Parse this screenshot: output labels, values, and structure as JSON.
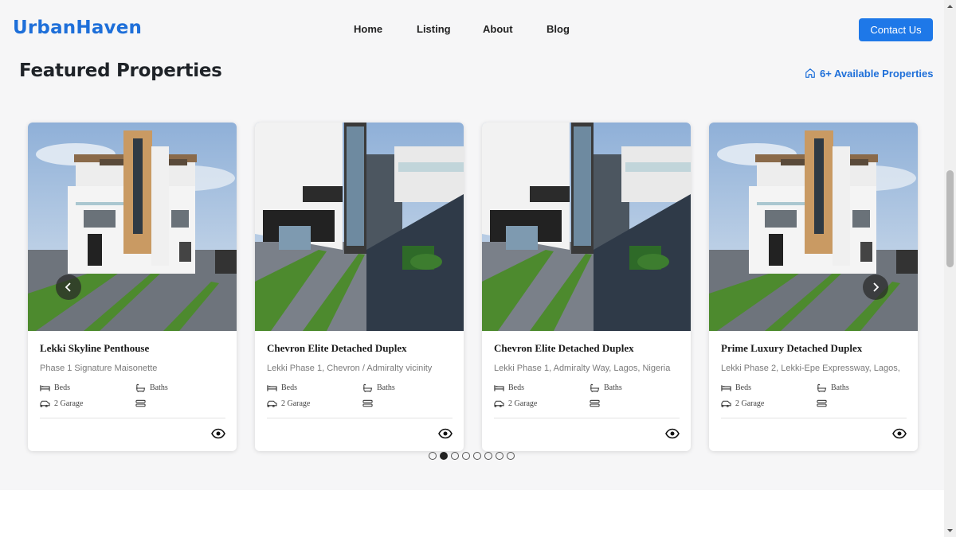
{
  "header": {
    "logo": "UrbanHaven",
    "nav": [
      "Home",
      "Listing",
      "About",
      "Blog"
    ],
    "contact_label": "Contact Us"
  },
  "section": {
    "title": "Featured Properties",
    "available": "6+ Available Properties"
  },
  "cards": [
    {
      "title": "Lekki Skyline Penthouse",
      "location": "Phase 1 Signature Maisonette",
      "beds": "Beds",
      "baths": "Baths",
      "garage": "2 Garage",
      "style": "A"
    },
    {
      "title": "Chevron Elite Detached Duplex",
      "location": "Lekki Phase 1, Chevron / Admiralty vicinity",
      "beds": "Beds",
      "baths": "Baths",
      "garage": "2 Garage",
      "style": "B"
    },
    {
      "title": "Chevron Elite Detached Duplex",
      "location": "Lekki Phase 1, Admiralty Way, Lagos, Nigeria",
      "beds": "Beds",
      "baths": "Baths",
      "garage": "2 Garage",
      "style": "B"
    },
    {
      "title": "Prime Luxury Detached Duplex",
      "location": "Lekki Phase 2, Lekki-Epe Expressway, Lagos,",
      "beds": "Beds",
      "baths": "Baths",
      "garage": "2 Garage",
      "style": "A"
    }
  ],
  "carousel": {
    "dot_count": 8,
    "active_dot": 1
  },
  "icons": {
    "available": "home-icon",
    "beds": "bed-icon",
    "baths": "bath-icon",
    "garage": "car-icon",
    "extra": "layers-icon",
    "view": "eye-icon",
    "prev": "chevron-left-icon",
    "next": "chevron-right-icon"
  },
  "colors": {
    "brand": "#1e6fd9",
    "button": "#1e78e8"
  }
}
